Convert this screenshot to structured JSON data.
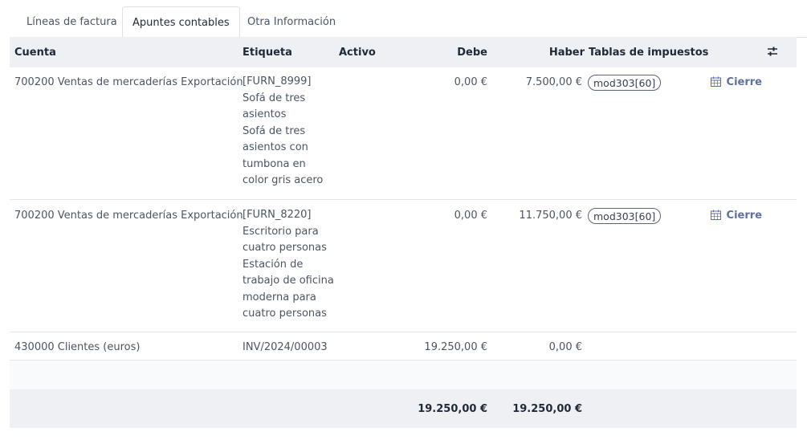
{
  "tabs": [
    {
      "label": "Líneas de factura"
    },
    {
      "label": "Apuntes contables"
    },
    {
      "label": "Otra Información"
    }
  ],
  "columns": {
    "cuenta": "Cuenta",
    "etiqueta": "Etiqueta",
    "activo": "Activo",
    "debe": "Debe",
    "haber": "Haber",
    "tablas": "Tablas de impuestos"
  },
  "rows": [
    {
      "cuenta": "700200 Ventas de mercaderías Exportación",
      "etiqueta": [
        "[FURN_8999]",
        "Sofá de tres",
        "asientos",
        "Sofá de tres",
        "asientos con",
        "tumbona en",
        "color gris acero"
      ],
      "debe": "0,00 €",
      "haber": "7.500,00 €",
      "tag": "mod303[60]",
      "action": "Cierre"
    },
    {
      "cuenta": "700200 Ventas de mercaderías Exportación",
      "etiqueta": [
        "[FURN_8220]",
        "Escritorio para",
        "cuatro personas",
        "Estación de",
        "trabajo de oficina",
        "moderna para",
        "cuatro personas"
      ],
      "debe": "0,00 €",
      "haber": "11.750,00 €",
      "tag": "mod303[60]",
      "action": "Cierre"
    },
    {
      "cuenta": "430000 Clientes (euros)",
      "etiqueta": [
        "INV/2024/00003"
      ],
      "debe": "19.250,00 €",
      "haber": "0,00 €",
      "tag": "",
      "action": ""
    }
  ],
  "totals": {
    "debe": "19.250,00 €",
    "haber": "19.250,00 €"
  },
  "icons": {
    "settings": "sliders-icon",
    "calendar": "calendar-icon"
  }
}
